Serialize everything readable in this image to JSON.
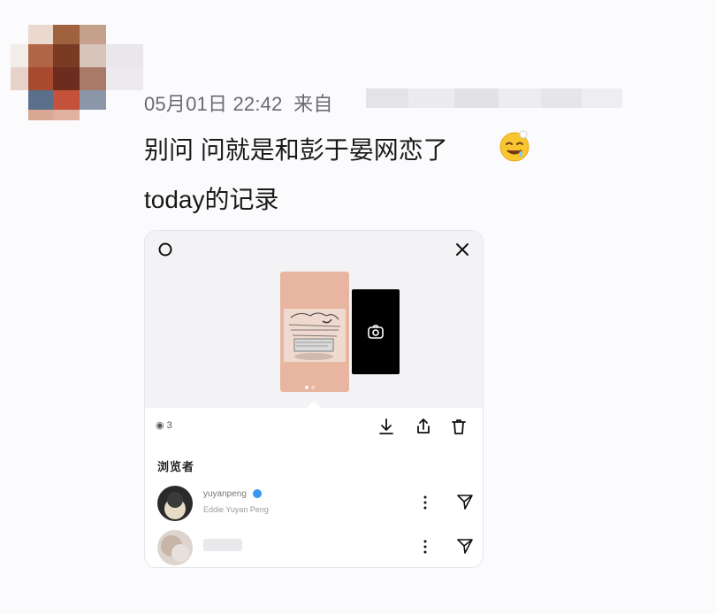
{
  "post": {
    "meta_date": "05月01日 22:42",
    "meta_source_prefix": "来自",
    "line1": "别问 问就是和彭于晏网恋了",
    "line2": "today的记录",
    "emoji": "drooling-face-emoji"
  },
  "story_card": {
    "view_count": "3",
    "viewers_title": "浏览者",
    "viewers": [
      {
        "name": "yuyanpeng",
        "sub": "Eddie Yuyan Peng",
        "verified": true
      },
      {
        "name": "",
        "sub": "",
        "verified": false
      }
    ],
    "icons": {
      "top_left": "circle-icon",
      "top_right": "close-icon",
      "camera": "camera-icon",
      "download": "download-icon",
      "share": "share-icon",
      "delete": "trash-icon",
      "more": "more-vertical-icon",
      "send": "send-icon",
      "views": "eye-icon"
    }
  },
  "colors": {
    "background": "#fbfbfd",
    "meta_text": "#6b6b70",
    "story_thumb": "#e8b5a1",
    "verified": "#3897f0"
  }
}
